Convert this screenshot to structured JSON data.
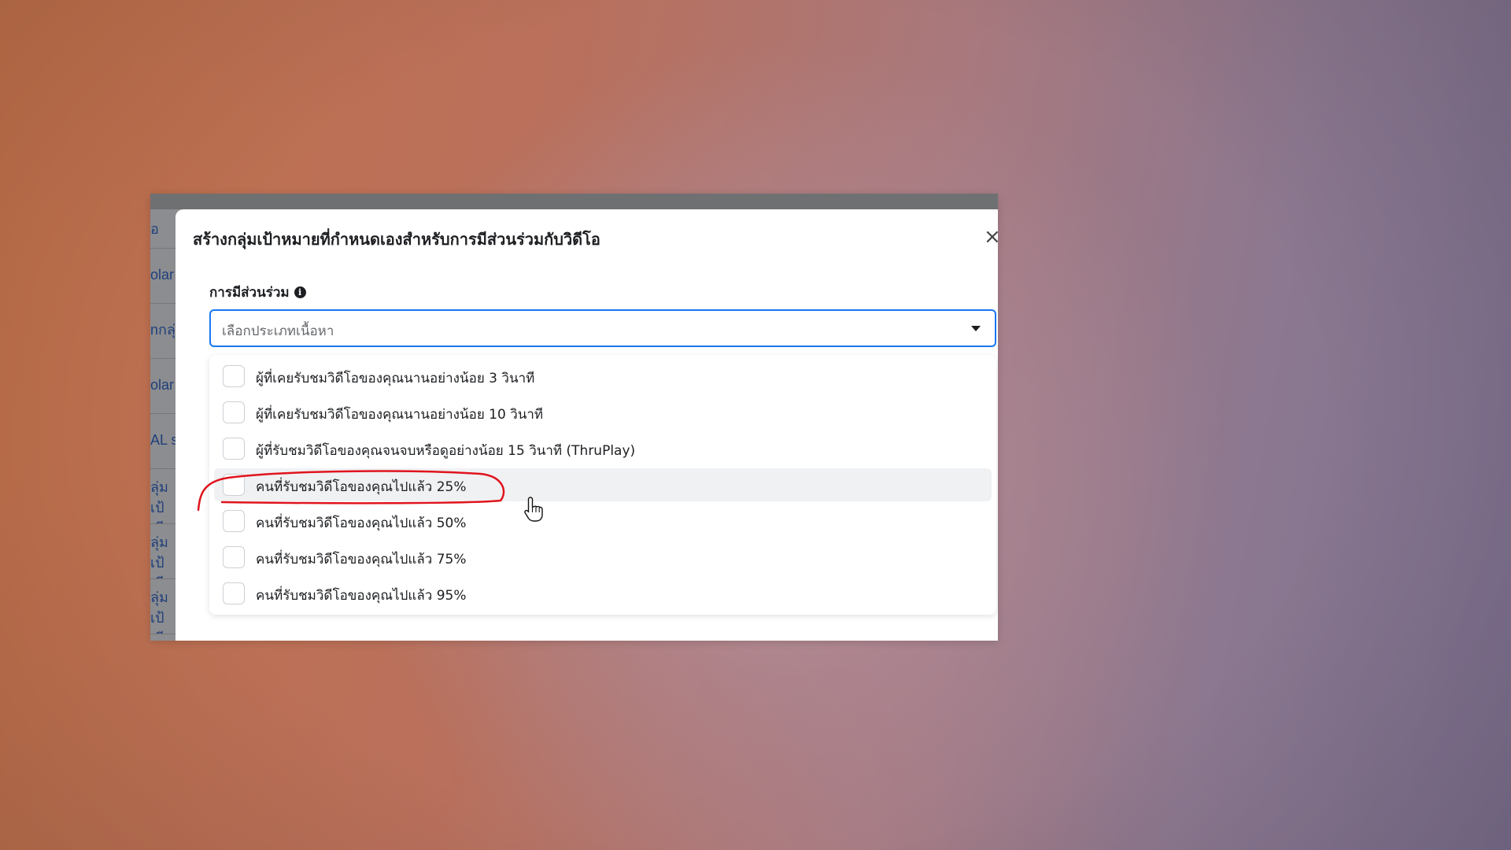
{
  "background_panel": {
    "cells": [
      "อ",
      "olar I",
      "nกลุ่ม",
      "olar I",
      "AL sc",
      "ลุ่มเป้ เฉีย",
      "ลุ่มเป้ เฉีย",
      "ลุ่มเป้ เฉีย"
    ]
  },
  "modal": {
    "title": "สร้างกลุ่มเป้าหมายที่กำหนดเองสำหรับการมีส่วนร่วมกับวิดีโอ",
    "close_symbol": "×",
    "field_label": "การมีส่วนร่วม",
    "info_symbol": "i",
    "select_placeholder": "เลือกประเภทเนื้อหา",
    "options": [
      {
        "label": "ผู้ที่เคยรับชมวิดีโอของคุณนานอย่างน้อย 3 วินาที",
        "checked": false
      },
      {
        "label": "ผู้ที่เคยรับชมวิดีโอของคุณนานอย่างน้อย 10 วินาที",
        "checked": false
      },
      {
        "label": "ผู้ที่รับชมวิดีโอของคุณจนจบหรือดูอย่างน้อย 15 วินาที (ThruPlay)",
        "checked": false
      },
      {
        "label": "คนที่รับชมวิดีโอของคุณไปแล้ว 25%",
        "checked": false,
        "hovered": true
      },
      {
        "label": "คนที่รับชมวิดีโอของคุณไปแล้ว 50%",
        "checked": false
      },
      {
        "label": "คนที่รับชมวิดีโอของคุณไปแล้ว 75%",
        "checked": false
      },
      {
        "label": "คนที่รับชมวิดีโอของคุณไปแล้ว 95%",
        "checked": false
      }
    ]
  },
  "colors": {
    "accent": "#1877f2",
    "primary_button_disabled": "#8ab4f8",
    "annotation": "#e0141e",
    "hover_row": "#f0f1f3"
  },
  "icons": {
    "info": "info-icon",
    "caret": "caret-down-icon",
    "close": "close-icon",
    "cursor": "hand-pointer-icon"
  }
}
